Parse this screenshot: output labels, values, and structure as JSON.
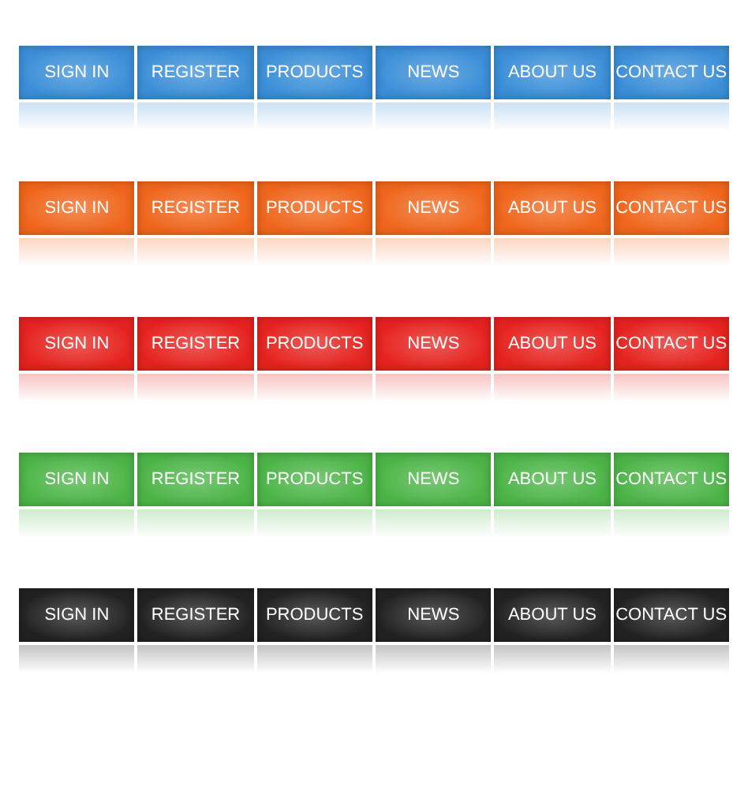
{
  "nav_bars": [
    {
      "color": "#3b8fd8",
      "buttons": [
        "SIGN IN",
        "REGISTER",
        "PRODUCTS",
        "NEWS",
        "ABOUT US",
        "CONTACT US"
      ]
    },
    {
      "color": "#f0661c",
      "buttons": [
        "SIGN IN",
        "REGISTER",
        "PRODUCTS",
        "NEWS",
        "ABOUT US",
        "CONTACT US"
      ]
    },
    {
      "color": "#e6231f",
      "buttons": [
        "SIGN IN",
        "REGISTER",
        "PRODUCTS",
        "NEWS",
        "ABOUT US",
        "CONTACT US"
      ]
    },
    {
      "color": "#4db548",
      "buttons": [
        "SIGN IN",
        "REGISTER",
        "PRODUCTS",
        "NEWS",
        "ABOUT US",
        "CONTACT US"
      ]
    },
    {
      "color": "#222222",
      "buttons": [
        "SIGN IN",
        "REGISTER",
        "PRODUCTS",
        "NEWS",
        "ABOUT US",
        "CONTACT US"
      ]
    }
  ]
}
